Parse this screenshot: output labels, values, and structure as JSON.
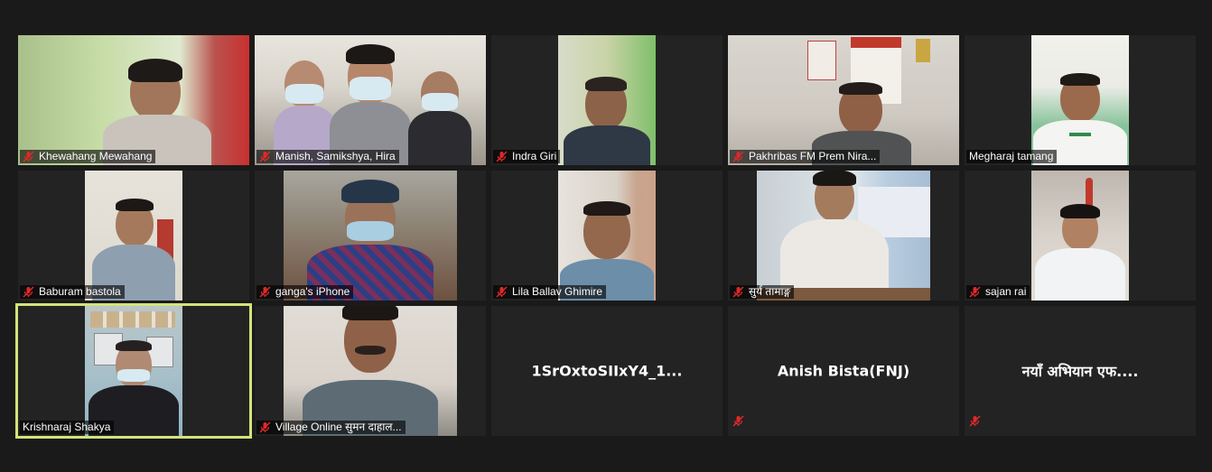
{
  "participants": [
    {
      "name": "Khewahang Mewahang",
      "muted": true
    },
    {
      "name": "Manish, Samikshya, Hira",
      "muted": true
    },
    {
      "name": "Indra Giri",
      "muted": true
    },
    {
      "name": "Pakhribas FM Prem Nira...",
      "muted": true
    },
    {
      "name": "Megharaj tamang",
      "muted": false
    },
    {
      "name": "Baburam bastola",
      "muted": true
    },
    {
      "name": "ganga's iPhone",
      "muted": true
    },
    {
      "name": "Lila Ballav Ghimire",
      "muted": true
    },
    {
      "name": "सुर्य तामाङ्ग",
      "muted": true
    },
    {
      "name": "sajan rai",
      "muted": true
    },
    {
      "name": "Krishnaraj Shakya",
      "muted": false,
      "active_speaker": true
    },
    {
      "name": "Village Online सुमन दाहाल...",
      "muted": true
    },
    {
      "name": "1SrOxtoSIIxY4_1...",
      "muted": false,
      "video_off": true
    },
    {
      "name": "Anish Bista(FNJ)",
      "muted": true,
      "video_off": true
    },
    {
      "name": "नयाँ अभियान एफ....",
      "muted": true,
      "video_off": true
    }
  ],
  "colors": {
    "background": "#1a1a1a",
    "tile": "#232323",
    "active_border": "#d3e37a",
    "muted_icon": "#e02828"
  }
}
